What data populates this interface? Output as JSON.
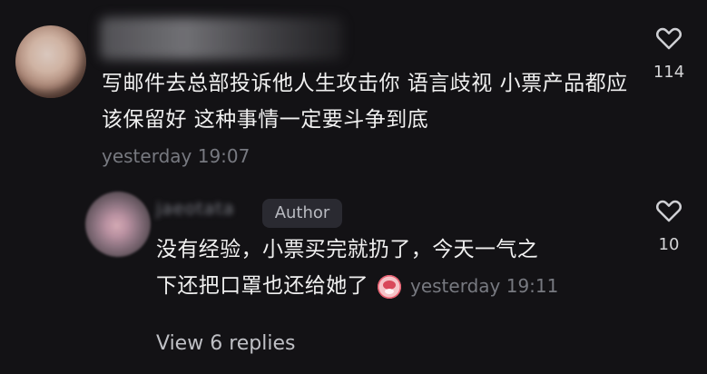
{
  "main_comment": {
    "text": "写邮件去总部投诉他人生攻击你 语言歧视 小票产品都应该保留好 这种事情一定要斗争到底",
    "timestamp": "yesterday 19:07",
    "like_count": "114",
    "heart_icon": "heart-icon"
  },
  "reply": {
    "username": "jaeotata",
    "author_badge": "Author",
    "text_line_one": "没有经验，小票买完就扔了，今天一气之",
    "text_line_two": "下还把口罩也还给她了",
    "emoji_icon": "screaming-face-icon",
    "timestamp": "yesterday 19:11",
    "like_count": "10",
    "heart_icon": "heart-icon"
  },
  "footer": {
    "view_replies": "View 6 replies"
  },
  "colors": {
    "background": "#131215",
    "primary_text": "#f0f0f0",
    "secondary_text": "#777980",
    "badge_background": "#2a2a31",
    "view_replies": "#bfc0c5"
  }
}
